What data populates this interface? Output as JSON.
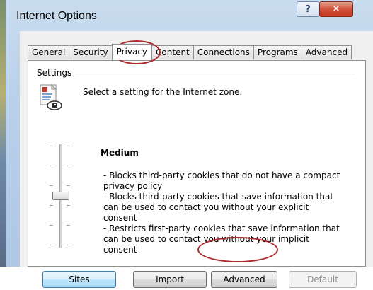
{
  "window": {
    "title": "Internet Options",
    "help_glyph": "?",
    "close_glyph": "✕"
  },
  "tabs": [
    {
      "label": "General",
      "active": false
    },
    {
      "label": "Security",
      "active": false
    },
    {
      "label": "Privacy",
      "active": true
    },
    {
      "label": "Content",
      "active": false
    },
    {
      "label": "Connections",
      "active": false
    },
    {
      "label": "Programs",
      "active": false
    },
    {
      "label": "Advanced",
      "active": false
    }
  ],
  "settings": {
    "group_label": "Settings",
    "zone_prompt": "Select a setting for the Internet zone.",
    "level": "Medium",
    "bullets": [
      "- Blocks third-party cookies that do not have a compact privacy policy",
      "- Blocks third-party cookies that save information that can be used to contact you without your explicit consent",
      "- Restricts first-party cookies that save information that can be used to contact you without your implicit consent"
    ]
  },
  "buttons": {
    "sites": "Sites",
    "import": "Import",
    "advanced": "Advanced",
    "default": "Default"
  },
  "colors": {
    "annotation": "#b02a2a",
    "close_button": "#c9452c",
    "selected_button": "#a7d9f5"
  }
}
